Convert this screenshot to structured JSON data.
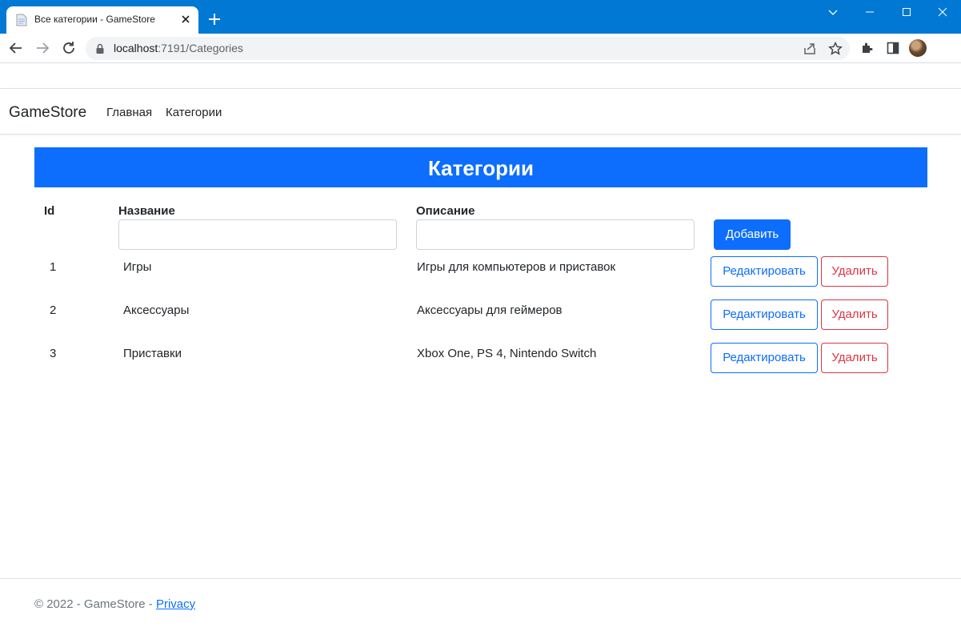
{
  "browser": {
    "tab_title": "Все категории - GameStore",
    "url_host": "localhost",
    "url_path": ":7191/Categories"
  },
  "nav": {
    "brand": "GameStore",
    "links": [
      "Главная",
      "Категории"
    ]
  },
  "page": {
    "title": "Категории",
    "columns": {
      "id": "Id",
      "name": "Название",
      "description": "Описание"
    },
    "add_button": "Добавить",
    "new_name_value": "",
    "new_description_value": "",
    "rows": [
      {
        "id": "1",
        "name": "Игры",
        "description": "Игры для компьютеров и приставок"
      },
      {
        "id": "2",
        "name": "Аксессуары",
        "description": "Аксессуары для геймеров"
      },
      {
        "id": "3",
        "name": "Приставки",
        "description": "Xbox One, PS 4, Nintendo Switch"
      }
    ],
    "edit_label": "Редактировать",
    "delete_label": "Удалить"
  },
  "footer": {
    "copyright": "© 2022 - GameStore - ",
    "privacy": "Privacy"
  },
  "colors": {
    "chrome_titlebar": "#0078d4",
    "primary": "#0d6efd",
    "danger": "#dc3545"
  },
  "icons": [
    "document-icon",
    "close-icon",
    "plus-icon",
    "chevron-down-icon",
    "minimize-icon",
    "maximize-icon",
    "window-close-icon",
    "back-arrow-icon",
    "forward-arrow-icon",
    "reload-icon",
    "lock-icon",
    "share-icon",
    "star-icon",
    "extensions-icon",
    "sidepanel-icon"
  ]
}
